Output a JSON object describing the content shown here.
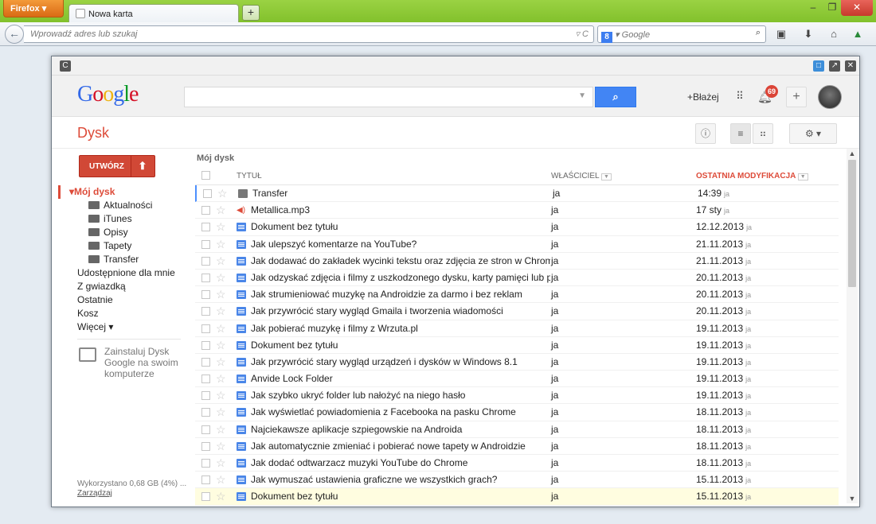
{
  "browser": {
    "menu_label": "Firefox",
    "tab_title": "Nowa karta",
    "newtab_label": "+",
    "url_placeholder": "Wprowadź adres lub szukaj",
    "search_placeholder": "Google",
    "search_engine_badge": "8",
    "window_controls": {
      "minimize": "–",
      "maximize": "❐",
      "close": "✕"
    }
  },
  "drive": {
    "logo": {
      "text": "Google",
      "letters": [
        {
          "ch": "G",
          "color": "#3369e8"
        },
        {
          "ch": "o",
          "color": "#d50f25"
        },
        {
          "ch": "o",
          "color": "#eeb211"
        },
        {
          "ch": "g",
          "color": "#3369e8"
        },
        {
          "ch": "l",
          "color": "#009925"
        },
        {
          "ch": "e",
          "color": "#d50f25"
        }
      ]
    },
    "user_name": "+Błażej",
    "notifications_count": "69",
    "plus_label": "+",
    "search_button_icon": "search-icon",
    "app_title": "Dysk",
    "create_label": "UTWÓRZ",
    "upload_icon": "upload-icon",
    "info_label": "ⓘ",
    "sidebar": {
      "my_drive": "▾Mój dysk",
      "folders": [
        "Aktualności",
        "iTunes",
        "Opisy",
        "Tapety",
        "Transfer"
      ],
      "items": [
        "Udostępnione dla mnie",
        "Z gwiazdką",
        "Ostatnie",
        "Kosz",
        "Więcej ▾"
      ],
      "install_text": "Zainstaluj Dysk Google na swoim komputerze",
      "storage_text": "Wykorzystano 0,68 GB (4%) ...",
      "manage_link": "Zarządzaj"
    },
    "breadcrumb": "Mój dysk",
    "columns": {
      "title": "TYTUŁ",
      "owner": "WŁAŚCICIEL",
      "modified": "OSTATNIA MODYFIKACJA"
    },
    "accent_color": "#dd4b39",
    "files": [
      {
        "icon": "folder",
        "title": "Transfer",
        "owner": "ja",
        "modified": "14:39",
        "by": "ja"
      },
      {
        "icon": "audio",
        "title": "Metallica.mp3",
        "owner": "ja",
        "modified": "17 sty",
        "by": "ja"
      },
      {
        "icon": "doc",
        "title": "Dokument bez tytułu",
        "owner": "ja",
        "modified": "12.12.2013",
        "by": "ja"
      },
      {
        "icon": "doc",
        "title": "Jak ulepszyć komentarze na YouTube?",
        "owner": "ja",
        "modified": "21.11.2013",
        "by": "ja"
      },
      {
        "icon": "doc",
        "title": "Jak dodawać do zakładek wycinki tekstu oraz zdjęcia ze stron w Chrome",
        "owner": "ja",
        "modified": "21.11.2013",
        "by": "ja"
      },
      {
        "icon": "doc",
        "title": "Jak odzyskać zdjęcia i filmy z uszkodzonego dysku, karty pamięci lub pend",
        "owner": "ja",
        "modified": "20.11.2013",
        "by": "ja"
      },
      {
        "icon": "doc",
        "title": "Jak strumieniować muzykę na Androidzie za darmo i bez reklam",
        "owner": "ja",
        "modified": "20.11.2013",
        "by": "ja"
      },
      {
        "icon": "doc",
        "title": "Jak przywrócić stary wygląd Gmaila i tworzenia wiadomości",
        "owner": "ja",
        "modified": "20.11.2013",
        "by": "ja"
      },
      {
        "icon": "doc",
        "title": "Jak pobierać muzykę i filmy z Wrzuta.pl",
        "owner": "ja",
        "modified": "19.11.2013",
        "by": "ja"
      },
      {
        "icon": "doc",
        "title": "Dokument bez tytułu",
        "owner": "ja",
        "modified": "19.11.2013",
        "by": "ja"
      },
      {
        "icon": "doc",
        "title": "Jak przywrócić stary wygląd urządzeń i dysków w Windows 8.1",
        "owner": "ja",
        "modified": "19.11.2013",
        "by": "ja"
      },
      {
        "icon": "doc",
        "title": "Anvide Lock Folder",
        "owner": "ja",
        "modified": "19.11.2013",
        "by": "ja"
      },
      {
        "icon": "doc",
        "title": "Jak szybko ukryć folder lub nałożyć na niego hasło",
        "owner": "ja",
        "modified": "19.11.2013",
        "by": "ja"
      },
      {
        "icon": "doc",
        "title": "Jak wyświetlać powiadomienia z Facebooka na pasku Chrome",
        "owner": "ja",
        "modified": "18.11.2013",
        "by": "ja"
      },
      {
        "icon": "doc",
        "title": "Najciekawsze aplikacje szpiegowskie na Androida",
        "owner": "ja",
        "modified": "18.11.2013",
        "by": "ja"
      },
      {
        "icon": "doc",
        "title": "Jak automatycznie zmieniać i pobierać nowe tapety w Androidzie",
        "owner": "ja",
        "modified": "18.11.2013",
        "by": "ja"
      },
      {
        "icon": "doc",
        "title": "Jak dodać odtwarzacz muzyki YouTube do Chrome",
        "owner": "ja",
        "modified": "18.11.2013",
        "by": "ja"
      },
      {
        "icon": "doc",
        "title": "Jak wymuszać ustawienia graficzne we wszystkich grach?",
        "owner": "ja",
        "modified": "15.11.2013",
        "by": "ja"
      },
      {
        "icon": "doc",
        "title": "Dokument bez tytułu",
        "owner": "ja",
        "modified": "15.11.2013",
        "by": "ja"
      }
    ]
  }
}
